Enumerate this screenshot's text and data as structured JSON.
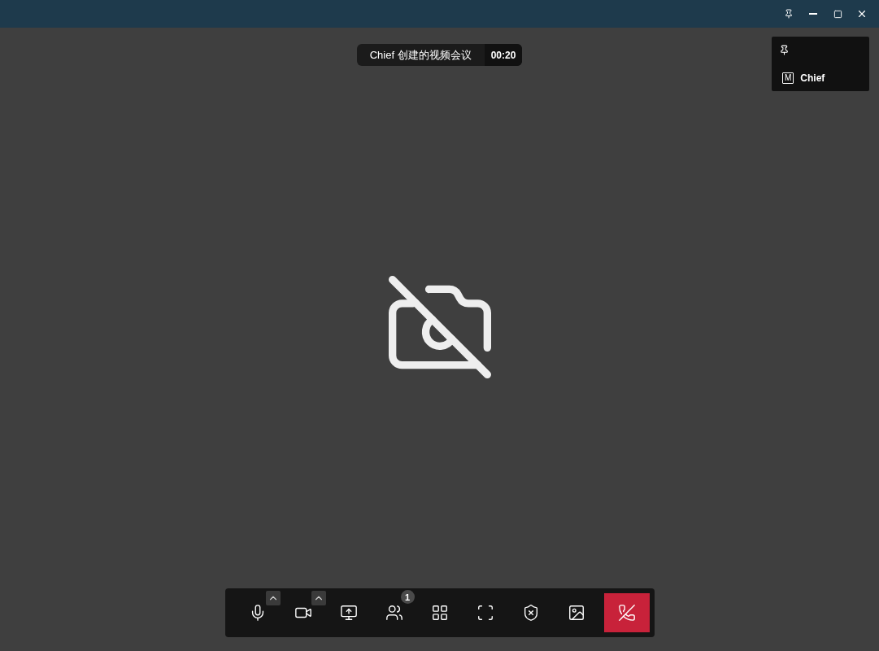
{
  "meeting": {
    "topic": "Chief 创建的视频会议",
    "timer": "00:20"
  },
  "self_view": {
    "role_badge": "M",
    "name": "Chief"
  },
  "toolbar": [
    {
      "kind": "mic",
      "has_menu": true
    },
    {
      "kind": "camera",
      "has_menu": true
    },
    {
      "kind": "share"
    },
    {
      "kind": "participants",
      "count": "1"
    },
    {
      "kind": "layout"
    },
    {
      "kind": "fullscreen"
    },
    {
      "kind": "security"
    },
    {
      "kind": "background"
    },
    {
      "kind": "hangup"
    }
  ]
}
